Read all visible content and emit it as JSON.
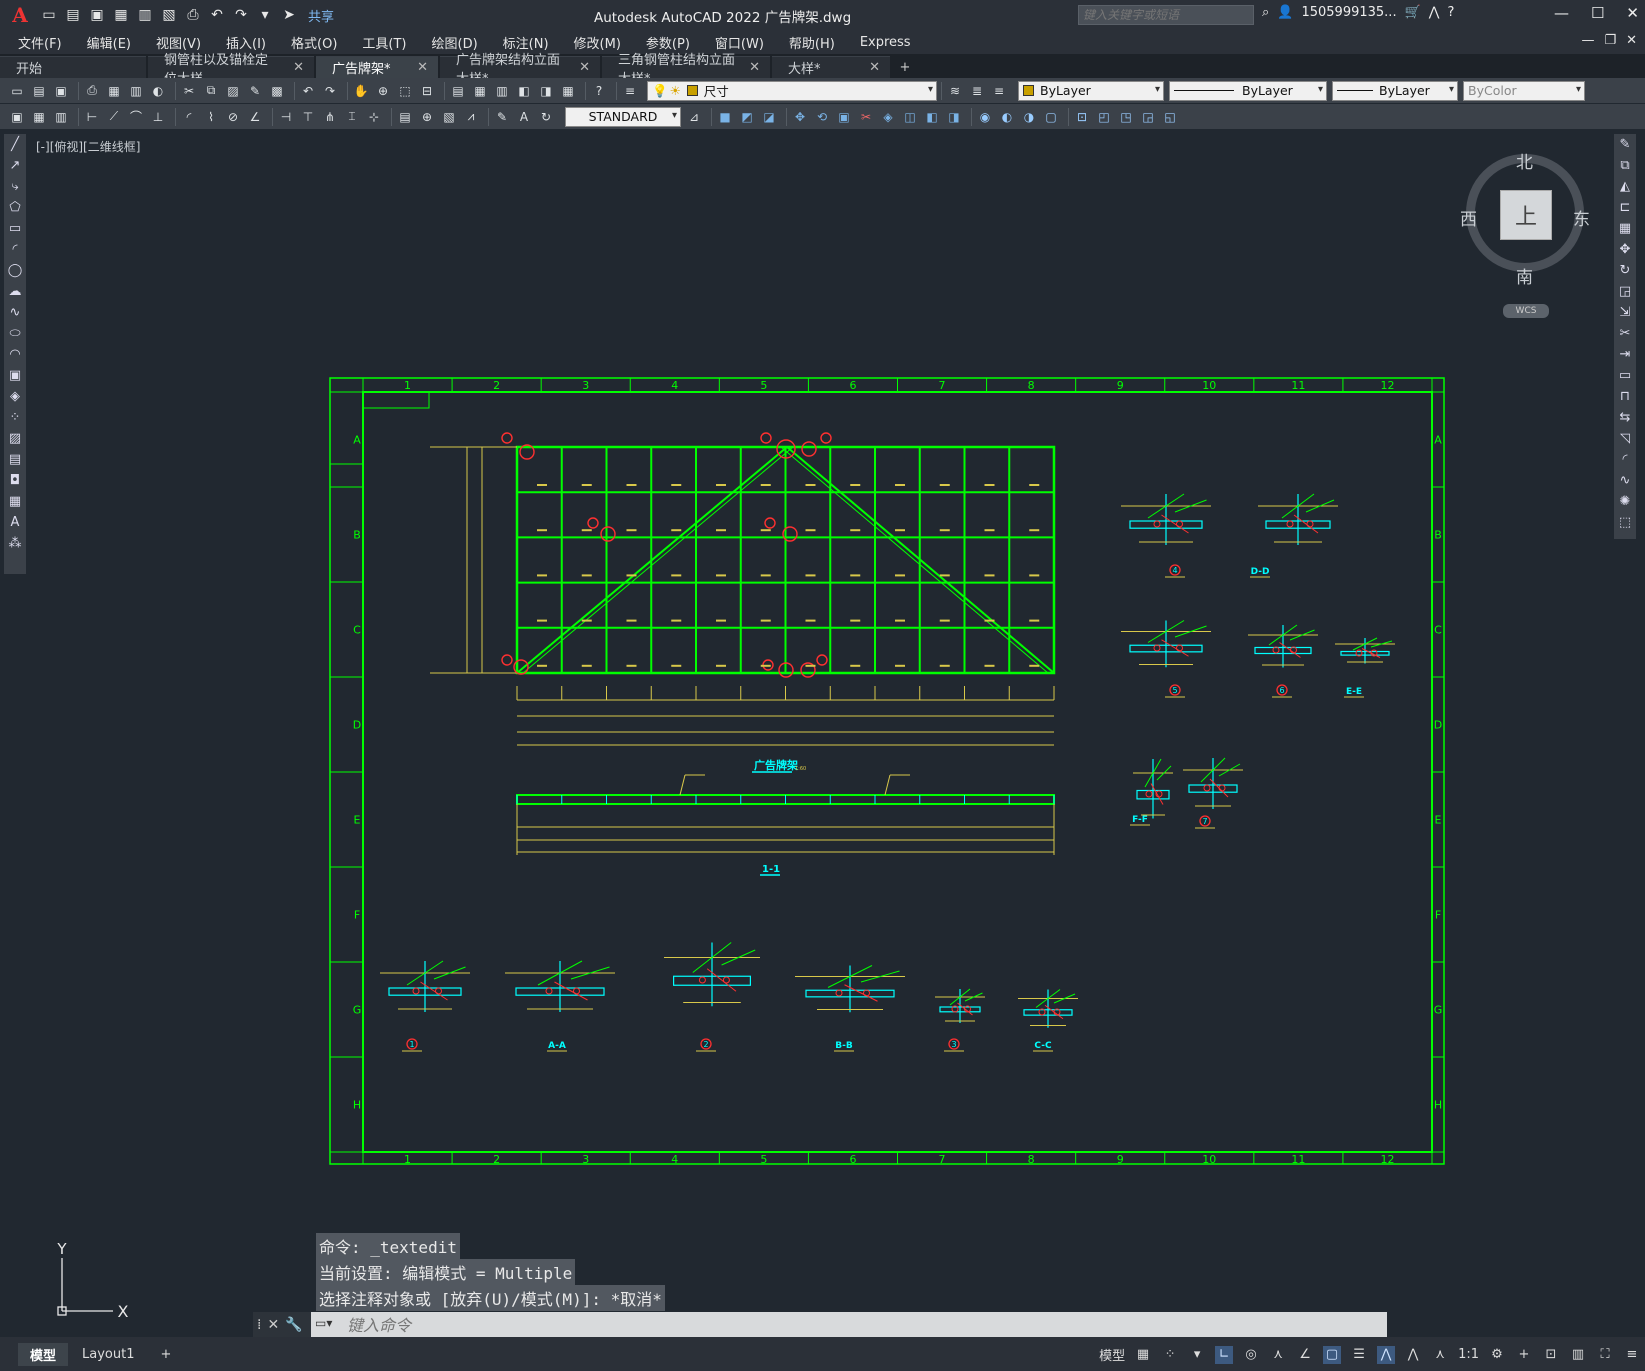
{
  "title_bar": {
    "app_letter": "A",
    "window_title": "Autodesk AutoCAD 2022    广告牌架.dwg",
    "share_label": "共享",
    "search_placeholder": "键入关键字或短语",
    "user": "1505999135...",
    "controls": [
      "—",
      "☐",
      "✕"
    ]
  },
  "menu": {
    "items": [
      "文件(F)",
      "编辑(E)",
      "视图(V)",
      "插入(I)",
      "格式(O)",
      "工具(T)",
      "绘图(D)",
      "标注(N)",
      "修改(M)",
      "参数(P)",
      "窗口(W)",
      "帮助(H)",
      "Express"
    ]
  },
  "tabs": [
    {
      "label": "开始",
      "closable": false
    },
    {
      "label": "钢管柱以及锚栓定位大样",
      "closable": true
    },
    {
      "label": "广告牌架*",
      "closable": true,
      "active": true
    },
    {
      "label": "广告牌架结构立面大样*",
      "closable": true
    },
    {
      "label": "三角钢管柱结构立面大样*",
      "closable": true
    },
    {
      "label": "大样*",
      "closable": true
    }
  ],
  "properties": {
    "layer": "尺寸",
    "color": "ByLayer",
    "linetype": "ByLayer",
    "lineweight": "ByLayer",
    "plotstyle": "ByColor",
    "text_style": "STANDARD"
  },
  "viewport_label": "[-][俯视][二维线框]",
  "viewcube": {
    "north": "北",
    "south": "南",
    "east": "东",
    "west": "西",
    "top_face": "上",
    "wcs": "WCS"
  },
  "ucs": {
    "y": "Y",
    "x": "X"
  },
  "drawing": {
    "frame_columns": [
      "1",
      "2",
      "3",
      "4",
      "5",
      "6",
      "7",
      "8",
      "9",
      "10",
      "11",
      "12"
    ],
    "frame_rows": [
      "A",
      "B",
      "C",
      "D",
      "E",
      "F",
      "G",
      "H"
    ],
    "main_title": "广告牌架",
    "section_title": "1-1",
    "detail_labels": [
      "4",
      "D-D",
      "5",
      "6",
      "E-E",
      "F-F",
      "7",
      "1",
      "A-A",
      "2",
      "B-B",
      "3",
      "C-C"
    ]
  },
  "command_history": [
    "命令: _textedit",
    "当前设置: 编辑模式 = Multiple",
    "选择注释对象或 [放弃(U)/模式(M)]: *取消*"
  ],
  "command_input": {
    "placeholder": "键入命令"
  },
  "layout_tabs": [
    "模型",
    "Layout1"
  ],
  "status": {
    "model_label": "模型",
    "scale": "1:1"
  },
  "colors": {
    "frame_green": "#00ff00",
    "canvas_bg": "#212830",
    "dim_yellow": "#d8c84a",
    "cyan": "#00e0ff",
    "red": "#ff2020"
  }
}
